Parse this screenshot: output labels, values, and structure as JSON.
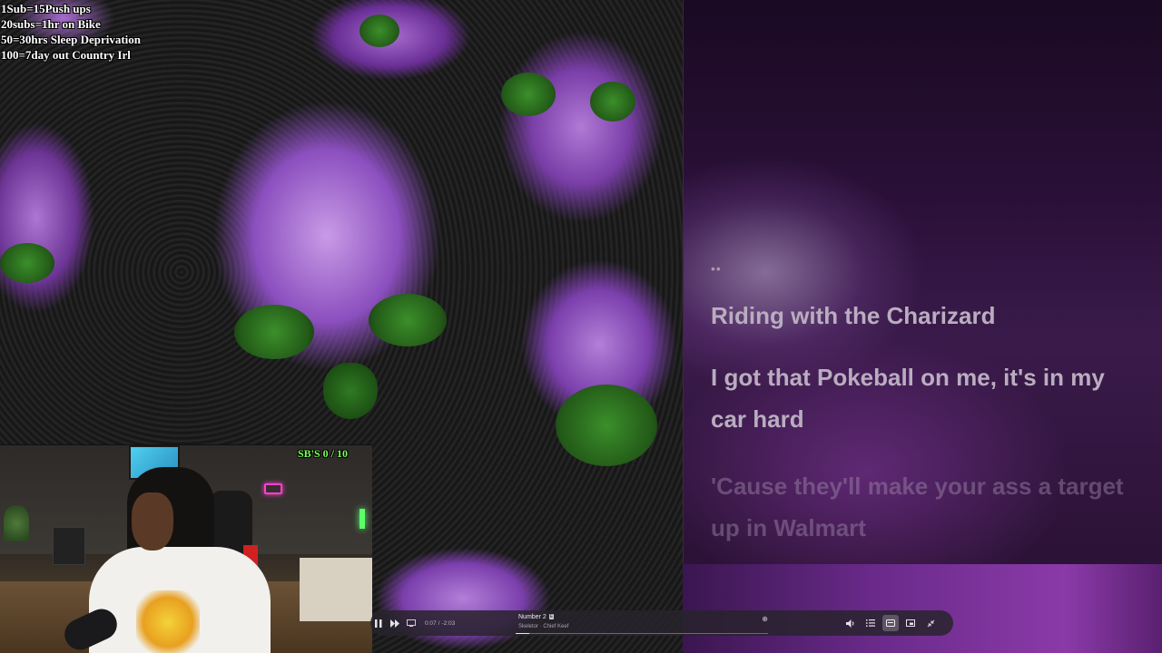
{
  "challenges": [
    "1Sub=15Push ups",
    "20subs=1hr on Bike",
    "50=30hrs Sleep Deprivation",
    "100=7day out Country Irl"
  ],
  "lyrics": {
    "dots": "••",
    "lines": [
      "Riding with the Charizard",
      "I got that Pokeball on me, it's in my car hard",
      "'Cause they'll make your ass a target up in Walmart"
    ]
  },
  "player": {
    "title": "Number 2",
    "explicit_badge": "E",
    "artist": "Skeletor · Chief Keef",
    "elapsed": "0:07",
    "separator": "/",
    "remaining": "-2:03",
    "progress_fraction": 0.054,
    "icons": {
      "pause": "pause-icon",
      "next": "next-icon",
      "cast": "cast-icon",
      "more": "more-icon",
      "volume": "volume-icon",
      "queue": "queue-icon",
      "lyrics": "lyrics-icon",
      "miniplayer": "miniplayer-icon",
      "collapse": "collapse-icon"
    }
  },
  "webcam": {
    "counter": "SB'S 0 / 10"
  },
  "colors": {
    "counter": "#7dff5a",
    "neon": "#ff3fd0",
    "skull_purple": "#b07ad6",
    "eye_green": "#3b8f2a"
  }
}
